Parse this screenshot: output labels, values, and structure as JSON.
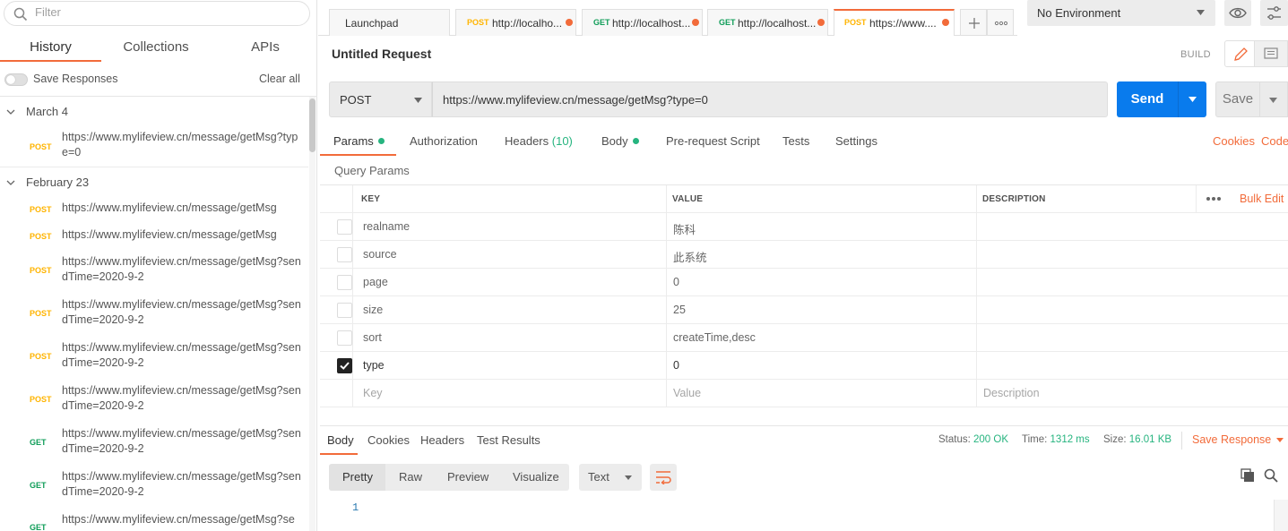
{
  "sidebar": {
    "filter_placeholder": "Filter",
    "tabs": [
      "History",
      "Collections",
      "APIs"
    ],
    "save_responses_label": "Save Responses",
    "clear_all_label": "Clear all",
    "groups": [
      {
        "date": "March 4",
        "items": [
          {
            "method": "POST",
            "url": "https://www.mylifeview.cn/message/getMsg?type=0"
          }
        ]
      },
      {
        "date": "February 23",
        "items": [
          {
            "method": "POST",
            "url": "https://www.mylifeview.cn/message/getMsg"
          },
          {
            "method": "POST",
            "url": "https://www.mylifeview.cn/message/getMsg"
          },
          {
            "method": "POST",
            "url": "https://www.mylifeview.cn/message/getMsg?sendTime=2020-9-2"
          },
          {
            "method": "POST",
            "url": "https://www.mylifeview.cn/message/getMsg?sendTime=2020-9-2"
          },
          {
            "method": "POST",
            "url": "https://www.mylifeview.cn/message/getMsg?sendTime=2020-9-2"
          },
          {
            "method": "POST",
            "url": "https://www.mylifeview.cn/message/getMsg?sendTime=2020-9-2"
          },
          {
            "method": "GET",
            "url": "https://www.mylifeview.cn/message/getMsg?sendTime=2020-9-2"
          },
          {
            "method": "GET",
            "url": "https://www.mylifeview.cn/message/getMsg?sendTime=2020-9-2"
          },
          {
            "method": "GET",
            "url": "https://www.mylifeview.cn/message/getMsg?se"
          }
        ]
      }
    ]
  },
  "tabs": [
    {
      "method": "",
      "label": "Launchpad"
    },
    {
      "method": "POST",
      "label": "http://localho..."
    },
    {
      "method": "GET",
      "label": "http://localhost..."
    },
    {
      "method": "GET",
      "label": "http://localhost..."
    },
    {
      "method": "POST",
      "label": "https://www...."
    }
  ],
  "environment": {
    "selected": "No Environment"
  },
  "request": {
    "name": "Untitled Request",
    "build_label": "BUILD",
    "method": "POST",
    "url": "https://www.mylifeview.cn/message/getMsg?type=0",
    "send_label": "Send",
    "save_label": "Save",
    "subtabs": {
      "params": "Params",
      "authorization": "Authorization",
      "headers": "Headers",
      "headers_count": "(10)",
      "body": "Body",
      "prerequest": "Pre-request Script",
      "tests": "Tests",
      "settings": "Settings"
    },
    "cookies_label": "Cookies",
    "code_label": "Code",
    "query_params_label": "Query Params",
    "columns": {
      "key": "KEY",
      "value": "VALUE",
      "description": "DESCRIPTION"
    },
    "bulk_edit_label": "Bulk Edit",
    "params": [
      {
        "checked": false,
        "key": "realname",
        "value": "陈科",
        "description": ""
      },
      {
        "checked": false,
        "key": "source",
        "value": "此系统",
        "description": ""
      },
      {
        "checked": false,
        "key": "page",
        "value": "0",
        "description": ""
      },
      {
        "checked": false,
        "key": "size",
        "value": "25",
        "description": ""
      },
      {
        "checked": false,
        "key": "sort",
        "value": "createTime,desc",
        "description": ""
      },
      {
        "checked": true,
        "key": "type",
        "value": "0",
        "description": ""
      }
    ],
    "placeholders": {
      "key": "Key",
      "value": "Value",
      "description": "Description"
    }
  },
  "response": {
    "tabs": [
      "Body",
      "Cookies",
      "Headers",
      "Test Results"
    ],
    "status_label": "Status:",
    "status_value": "200 OK",
    "time_label": "Time:",
    "time_value": "1312 ms",
    "size_label": "Size:",
    "size_value": "16.01 KB",
    "save_response_label": "Save Response",
    "formats": [
      "Pretty",
      "Raw",
      "Preview",
      "Visualize"
    ],
    "type_selected": "Text",
    "line_number": "1"
  },
  "colors": {
    "accent": "#f26b3a",
    "send_blue": "#097bed",
    "post": "#ffb400",
    "get": "#0f9d58",
    "status_green": "#26b47f"
  }
}
